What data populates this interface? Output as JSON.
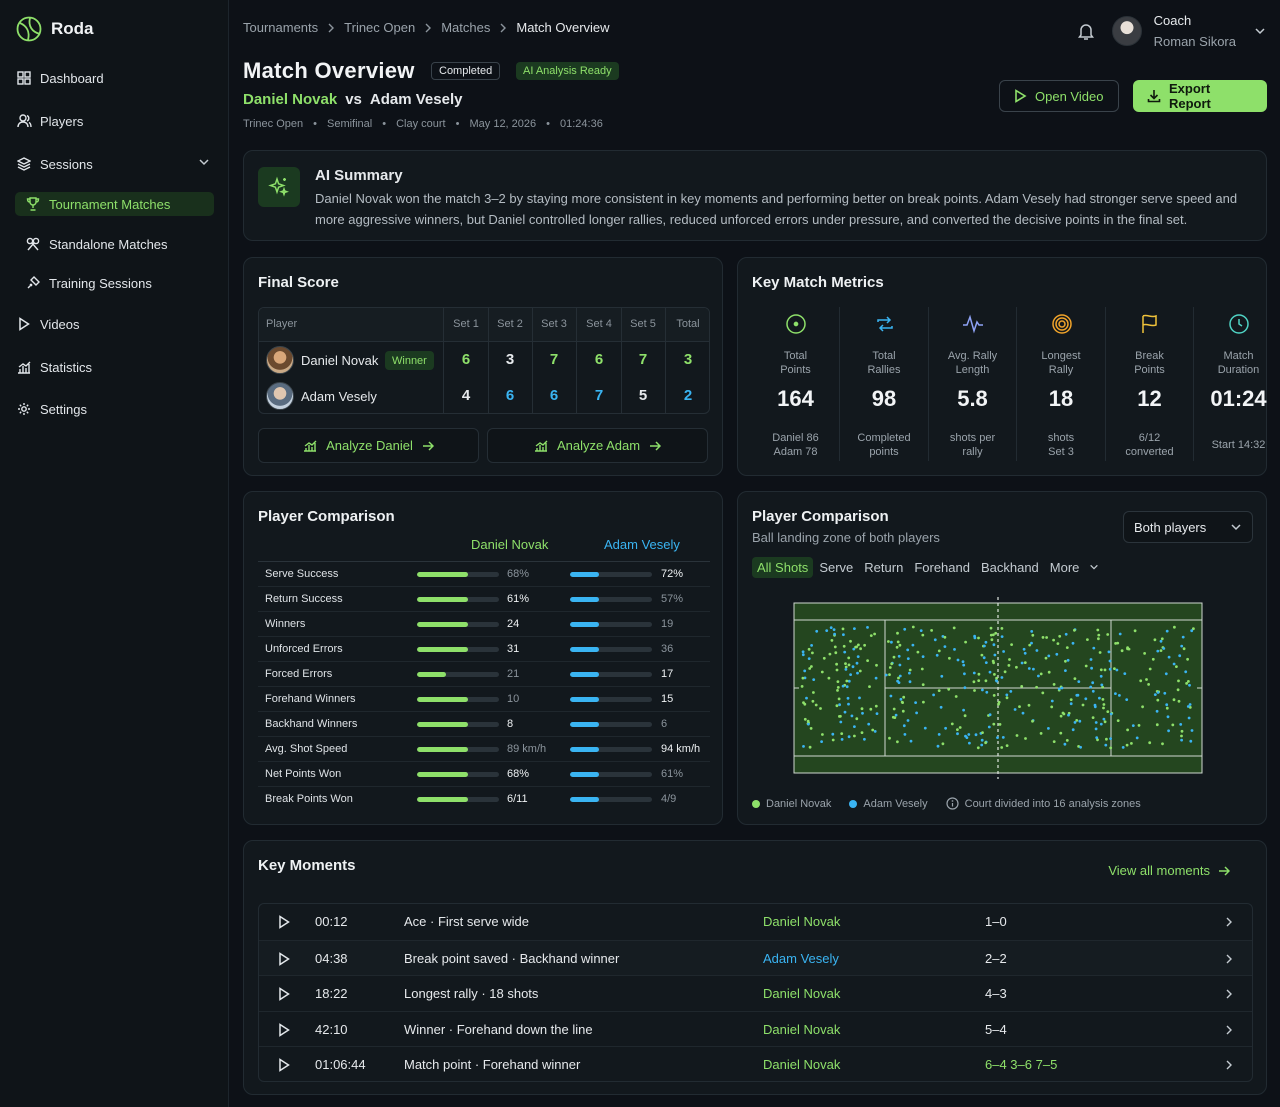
{
  "app": {
    "name": "Roda"
  },
  "sidebar": {
    "items": [
      {
        "label": "Dashboard",
        "icon": "dashboard-icon"
      },
      {
        "label": "Players",
        "icon": "players-icon"
      },
      {
        "label": "Sessions",
        "icon": "sessions-icon"
      },
      {
        "label": "Tournament Matches",
        "icon": "trophy-icon"
      },
      {
        "label": "Standalone Matches",
        "icon": "crossed-rackets-icon"
      },
      {
        "label": "Training Sessions",
        "icon": "training-icon"
      },
      {
        "label": "Videos",
        "icon": "play-icon"
      },
      {
        "label": "Statistics",
        "icon": "statistics-icon"
      },
      {
        "label": "Settings",
        "icon": "gear-icon"
      }
    ]
  },
  "breadcrumb": [
    "Tournaments",
    "Trinec Open",
    "Matches",
    "Match Overview"
  ],
  "user": {
    "role": "Coach",
    "name": "Roman Sikora"
  },
  "header": {
    "title": "Match Overview",
    "status": "Completed",
    "ai_badge": "AI Analysis Ready",
    "player1": "Daniel Novak",
    "vs": "vs",
    "player2": "Adam Vesely",
    "meta": [
      "Trinec Open",
      "Semifinal",
      "Clay court",
      "May 12, 2026",
      "01:24:36"
    ],
    "meta_sep": "•",
    "open_video": "Open Video",
    "export": "Export Report"
  },
  "ai_summary": {
    "title": "AI Summary",
    "text": "Daniel Novak won the match 3–2 by staying more consistent in key moments and performing better on break points. Adam Vesely had stronger serve speed and more aggressive winners, but Daniel controlled longer rallies, reduced unforced errors under pressure, and converted the decisive points in the final set."
  },
  "final_score": {
    "title": "Final Score",
    "headers": [
      "Player",
      "Set 1",
      "Set 2",
      "Set 3",
      "Set 4",
      "Set 5",
      "Total"
    ],
    "winner_badge": "Winner",
    "rows": [
      {
        "name": "Daniel Novak",
        "scores": [
          "6",
          "3",
          "7",
          "6",
          "7",
          "3"
        ]
      },
      {
        "name": "Adam Vesely",
        "scores": [
          "4",
          "6",
          "6",
          "7",
          "5",
          "2"
        ]
      }
    ],
    "analyze1": "Analyze Daniel",
    "analyze2": "Analyze Adam"
  },
  "metrics": {
    "title": "Key Match Metrics",
    "items": [
      {
        "label1": "Total",
        "label2": "Points",
        "value": "164",
        "sub1": "Daniel 86",
        "sub2": "Adam 78",
        "icon": "target-circle-icon"
      },
      {
        "label1": "Total",
        "label2": "Rallies",
        "value": "98",
        "sub1": "Completed",
        "sub2": "points",
        "icon": "repeat-icon"
      },
      {
        "label1": "Avg. Rally",
        "label2": "Length",
        "value": "5.8",
        "sub1": "shots per",
        "sub2": "rally",
        "icon": "pulse-icon"
      },
      {
        "label1": "Longest",
        "label2": "Rally",
        "value": "18",
        "sub1": "shots",
        "sub2": "Set 3",
        "icon": "bullseye-icon"
      },
      {
        "label1": "Break",
        "label2": "Points",
        "value": "12",
        "sub1": "6/12",
        "sub2": "converted",
        "icon": "flag-icon"
      },
      {
        "label1": "Match",
        "label2": "Duration",
        "value": "01:24",
        "sub1": "Start 14:32",
        "sub2": "",
        "icon": "clock-icon"
      }
    ]
  },
  "comparison": {
    "title": "Player Comparison",
    "p1": "Daniel Novak",
    "p2": "Adam Vesely",
    "rows": [
      {
        "label": "Serve Success",
        "v1": "68%",
        "v2": "72%",
        "f1": 0.62,
        "f2": 0.35,
        "hi": 2
      },
      {
        "label": "Return Success",
        "v1": "61%",
        "v2": "57%",
        "f1": 0.62,
        "f2": 0.35,
        "hi": 1
      },
      {
        "label": "Winners",
        "v1": "24",
        "v2": "19",
        "f1": 0.62,
        "f2": 0.35,
        "hi": 1
      },
      {
        "label": "Unforced Errors",
        "v1": "31",
        "v2": "36",
        "f1": 0.62,
        "f2": 0.35,
        "hi": 1
      },
      {
        "label": "Forced Errors",
        "v1": "21",
        "v2": "17",
        "f1": 0.35,
        "f2": 0.35,
        "hi": 2
      },
      {
        "label": "Forehand Winners",
        "v1": "10",
        "v2": "15",
        "f1": 0.62,
        "f2": 0.35,
        "hi": 2
      },
      {
        "label": "Backhand Winners",
        "v1": "8",
        "v2": "6",
        "f1": 0.62,
        "f2": 0.35,
        "hi": 1
      },
      {
        "label": "Avg. Shot Speed",
        "v1": "89 km/h",
        "v2": "94 km/h",
        "f1": 0.62,
        "f2": 0.35,
        "hi": 2
      },
      {
        "label": "Net Points Won",
        "v1": "68%",
        "v2": "61%",
        "f1": 0.62,
        "f2": 0.35,
        "hi": 1
      },
      {
        "label": "Break Points Won",
        "v1": "6/11",
        "v2": "4/9",
        "f1": 0.62,
        "f2": 0.35,
        "hi": 1
      }
    ]
  },
  "landing": {
    "title": "Player Comparison",
    "subtitle": "Ball landing zone of both players",
    "dropdown": "Both players",
    "tabs": [
      "All Shots",
      "Serve",
      "Return",
      "Forehand",
      "Backhand",
      "More"
    ],
    "legend1": "Daniel Novak",
    "legend2": "Adam Vesely",
    "note": "Court divided into 16 analysis zones"
  },
  "key_moments": {
    "title": "Key Moments",
    "view_all": "View all moments",
    "rows": [
      {
        "time": "00:12",
        "event": "Ace · First serve wide",
        "player": "Daniel Novak",
        "pcolor": "green",
        "score": "1–0"
      },
      {
        "time": "04:38",
        "event": "Break point saved · Backhand winner",
        "player": "Adam Vesely",
        "pcolor": "blue",
        "score": "2–2"
      },
      {
        "time": "18:22",
        "event": "Longest rally · 18 shots",
        "player": "Daniel Novak",
        "pcolor": "green",
        "score": "4–3"
      },
      {
        "time": "42:10",
        "event": "Winner · Forehand down the line",
        "player": "Daniel Novak",
        "pcolor": "green",
        "score": "5–4"
      },
      {
        "time": "01:06:44",
        "event": "Match point · Forehand winner",
        "player": "Daniel Novak",
        "pcolor": "green",
        "score": "6–4 3–6 7–5"
      }
    ]
  },
  "colors": {
    "accent": "#8ee06a",
    "blue": "#3ab4f2",
    "bg": "#0d1117",
    "card": "#12181d",
    "court": "#24461f"
  }
}
